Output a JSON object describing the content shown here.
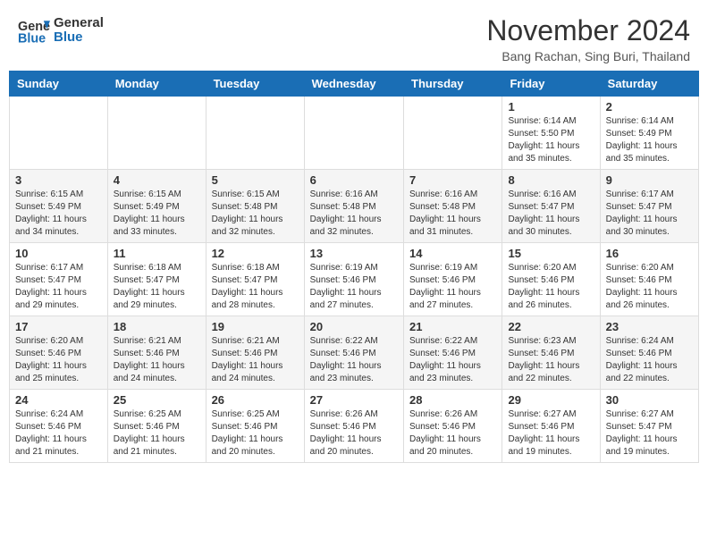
{
  "header": {
    "logo_line1": "General",
    "logo_line2": "Blue",
    "month_title": "November 2024",
    "location": "Bang Rachan, Sing Buri, Thailand"
  },
  "weekdays": [
    "Sunday",
    "Monday",
    "Tuesday",
    "Wednesday",
    "Thursday",
    "Friday",
    "Saturday"
  ],
  "weeks": [
    [
      {
        "day": "",
        "info": ""
      },
      {
        "day": "",
        "info": ""
      },
      {
        "day": "",
        "info": ""
      },
      {
        "day": "",
        "info": ""
      },
      {
        "day": "",
        "info": ""
      },
      {
        "day": "1",
        "info": "Sunrise: 6:14 AM\nSunset: 5:50 PM\nDaylight: 11 hours and 35 minutes."
      },
      {
        "day": "2",
        "info": "Sunrise: 6:14 AM\nSunset: 5:49 PM\nDaylight: 11 hours and 35 minutes."
      }
    ],
    [
      {
        "day": "3",
        "info": "Sunrise: 6:15 AM\nSunset: 5:49 PM\nDaylight: 11 hours and 34 minutes."
      },
      {
        "day": "4",
        "info": "Sunrise: 6:15 AM\nSunset: 5:49 PM\nDaylight: 11 hours and 33 minutes."
      },
      {
        "day": "5",
        "info": "Sunrise: 6:15 AM\nSunset: 5:48 PM\nDaylight: 11 hours and 32 minutes."
      },
      {
        "day": "6",
        "info": "Sunrise: 6:16 AM\nSunset: 5:48 PM\nDaylight: 11 hours and 32 minutes."
      },
      {
        "day": "7",
        "info": "Sunrise: 6:16 AM\nSunset: 5:48 PM\nDaylight: 11 hours and 31 minutes."
      },
      {
        "day": "8",
        "info": "Sunrise: 6:16 AM\nSunset: 5:47 PM\nDaylight: 11 hours and 30 minutes."
      },
      {
        "day": "9",
        "info": "Sunrise: 6:17 AM\nSunset: 5:47 PM\nDaylight: 11 hours and 30 minutes."
      }
    ],
    [
      {
        "day": "10",
        "info": "Sunrise: 6:17 AM\nSunset: 5:47 PM\nDaylight: 11 hours and 29 minutes."
      },
      {
        "day": "11",
        "info": "Sunrise: 6:18 AM\nSunset: 5:47 PM\nDaylight: 11 hours and 29 minutes."
      },
      {
        "day": "12",
        "info": "Sunrise: 6:18 AM\nSunset: 5:47 PM\nDaylight: 11 hours and 28 minutes."
      },
      {
        "day": "13",
        "info": "Sunrise: 6:19 AM\nSunset: 5:46 PM\nDaylight: 11 hours and 27 minutes."
      },
      {
        "day": "14",
        "info": "Sunrise: 6:19 AM\nSunset: 5:46 PM\nDaylight: 11 hours and 27 minutes."
      },
      {
        "day": "15",
        "info": "Sunrise: 6:20 AM\nSunset: 5:46 PM\nDaylight: 11 hours and 26 minutes."
      },
      {
        "day": "16",
        "info": "Sunrise: 6:20 AM\nSunset: 5:46 PM\nDaylight: 11 hours and 26 minutes."
      }
    ],
    [
      {
        "day": "17",
        "info": "Sunrise: 6:20 AM\nSunset: 5:46 PM\nDaylight: 11 hours and 25 minutes."
      },
      {
        "day": "18",
        "info": "Sunrise: 6:21 AM\nSunset: 5:46 PM\nDaylight: 11 hours and 24 minutes."
      },
      {
        "day": "19",
        "info": "Sunrise: 6:21 AM\nSunset: 5:46 PM\nDaylight: 11 hours and 24 minutes."
      },
      {
        "day": "20",
        "info": "Sunrise: 6:22 AM\nSunset: 5:46 PM\nDaylight: 11 hours and 23 minutes."
      },
      {
        "day": "21",
        "info": "Sunrise: 6:22 AM\nSunset: 5:46 PM\nDaylight: 11 hours and 23 minutes."
      },
      {
        "day": "22",
        "info": "Sunrise: 6:23 AM\nSunset: 5:46 PM\nDaylight: 11 hours and 22 minutes."
      },
      {
        "day": "23",
        "info": "Sunrise: 6:24 AM\nSunset: 5:46 PM\nDaylight: 11 hours and 22 minutes."
      }
    ],
    [
      {
        "day": "24",
        "info": "Sunrise: 6:24 AM\nSunset: 5:46 PM\nDaylight: 11 hours and 21 minutes."
      },
      {
        "day": "25",
        "info": "Sunrise: 6:25 AM\nSunset: 5:46 PM\nDaylight: 11 hours and 21 minutes."
      },
      {
        "day": "26",
        "info": "Sunrise: 6:25 AM\nSunset: 5:46 PM\nDaylight: 11 hours and 20 minutes."
      },
      {
        "day": "27",
        "info": "Sunrise: 6:26 AM\nSunset: 5:46 PM\nDaylight: 11 hours and 20 minutes."
      },
      {
        "day": "28",
        "info": "Sunrise: 6:26 AM\nSunset: 5:46 PM\nDaylight: 11 hours and 20 minutes."
      },
      {
        "day": "29",
        "info": "Sunrise: 6:27 AM\nSunset: 5:46 PM\nDaylight: 11 hours and 19 minutes."
      },
      {
        "day": "30",
        "info": "Sunrise: 6:27 AM\nSunset: 5:47 PM\nDaylight: 11 hours and 19 minutes."
      }
    ]
  ]
}
